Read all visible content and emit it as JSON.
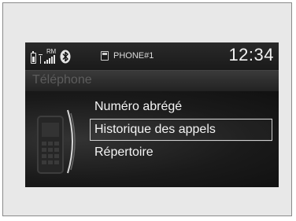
{
  "status_bar": {
    "roam_indicator": "RM",
    "phone_name": "PHONE#1",
    "clock": "12:34",
    "icons": [
      "battery-icon",
      "signal-strength-icon",
      "bluetooth-icon",
      "phone-device-icon"
    ]
  },
  "title": "Téléphone",
  "menu": {
    "items": [
      {
        "label": "Numéro abrégé"
      },
      {
        "label": "Historique des appels",
        "selected": true
      },
      {
        "label": "Répertoire"
      }
    ]
  },
  "colors": {
    "screen_background": "#151515",
    "text": "#f4f4f4",
    "title_text": "#5d5d5d",
    "selection_border": "#cfcfcf"
  }
}
